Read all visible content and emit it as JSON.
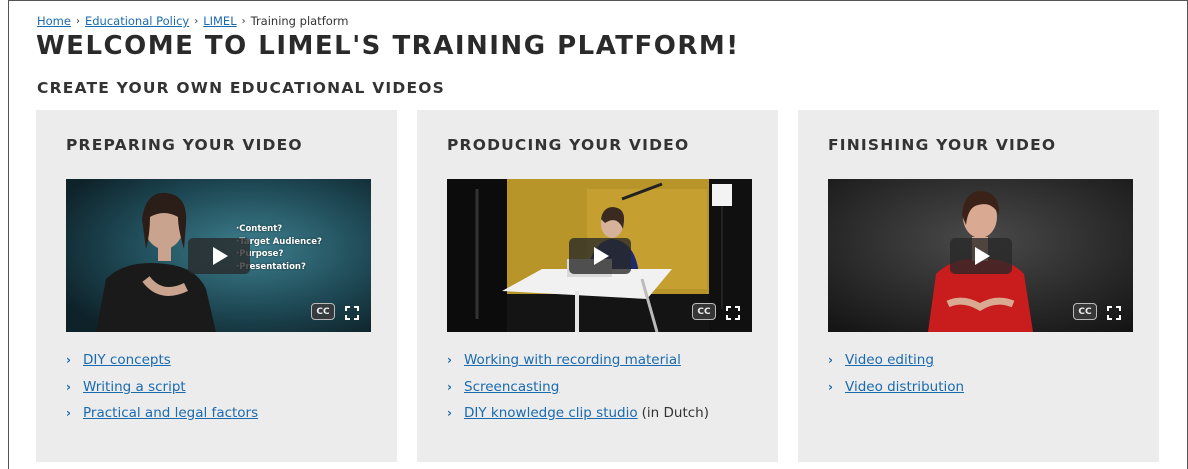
{
  "breadcrumb": {
    "items": [
      {
        "label": "Home",
        "link": true
      },
      {
        "label": "Educational Policy",
        "link": true
      },
      {
        "label": "LIMEL",
        "link": true
      },
      {
        "label": "Training platform",
        "link": false
      }
    ],
    "separator": "›"
  },
  "page": {
    "title": "WELCOME TO LIMEL'S TRAINING PLATFORM!",
    "subtitle": "CREATE YOUR OWN EDUCATIONAL VIDEOS"
  },
  "cards": [
    {
      "title": "PREPARING YOUR VIDEO",
      "video": {
        "overlay_lines": [
          "·Content?",
          "·Target Audience?",
          "·Purpose?",
          "·Presentation?"
        ],
        "cc_label": "CC"
      },
      "links": [
        {
          "label": "DIY concepts"
        },
        {
          "label": "Writing a script"
        },
        {
          "label": "Practical and legal factors"
        }
      ]
    },
    {
      "title": "PRODUCING YOUR VIDEO",
      "video": {
        "cc_label": "CC"
      },
      "links": [
        {
          "label": "Working with recording material"
        },
        {
          "label": "Screencasting"
        },
        {
          "label": "DIY knowledge clip studio",
          "note": "(in Dutch)"
        }
      ]
    },
    {
      "title": "FINISHING YOUR VIDEO",
      "video": {
        "cc_label": "CC"
      },
      "links": [
        {
          "label": "Video editing"
        },
        {
          "label": "Video distribution"
        }
      ]
    }
  ],
  "colors": {
    "link": "#1a6ab0",
    "card_bg": "#ececec",
    "heading": "#2a2a2a"
  },
  "icons": {
    "play": "play-icon",
    "cc": "closed-captions-icon",
    "fullscreen": "fullscreen-icon",
    "chevron": "chevron-right-icon"
  }
}
